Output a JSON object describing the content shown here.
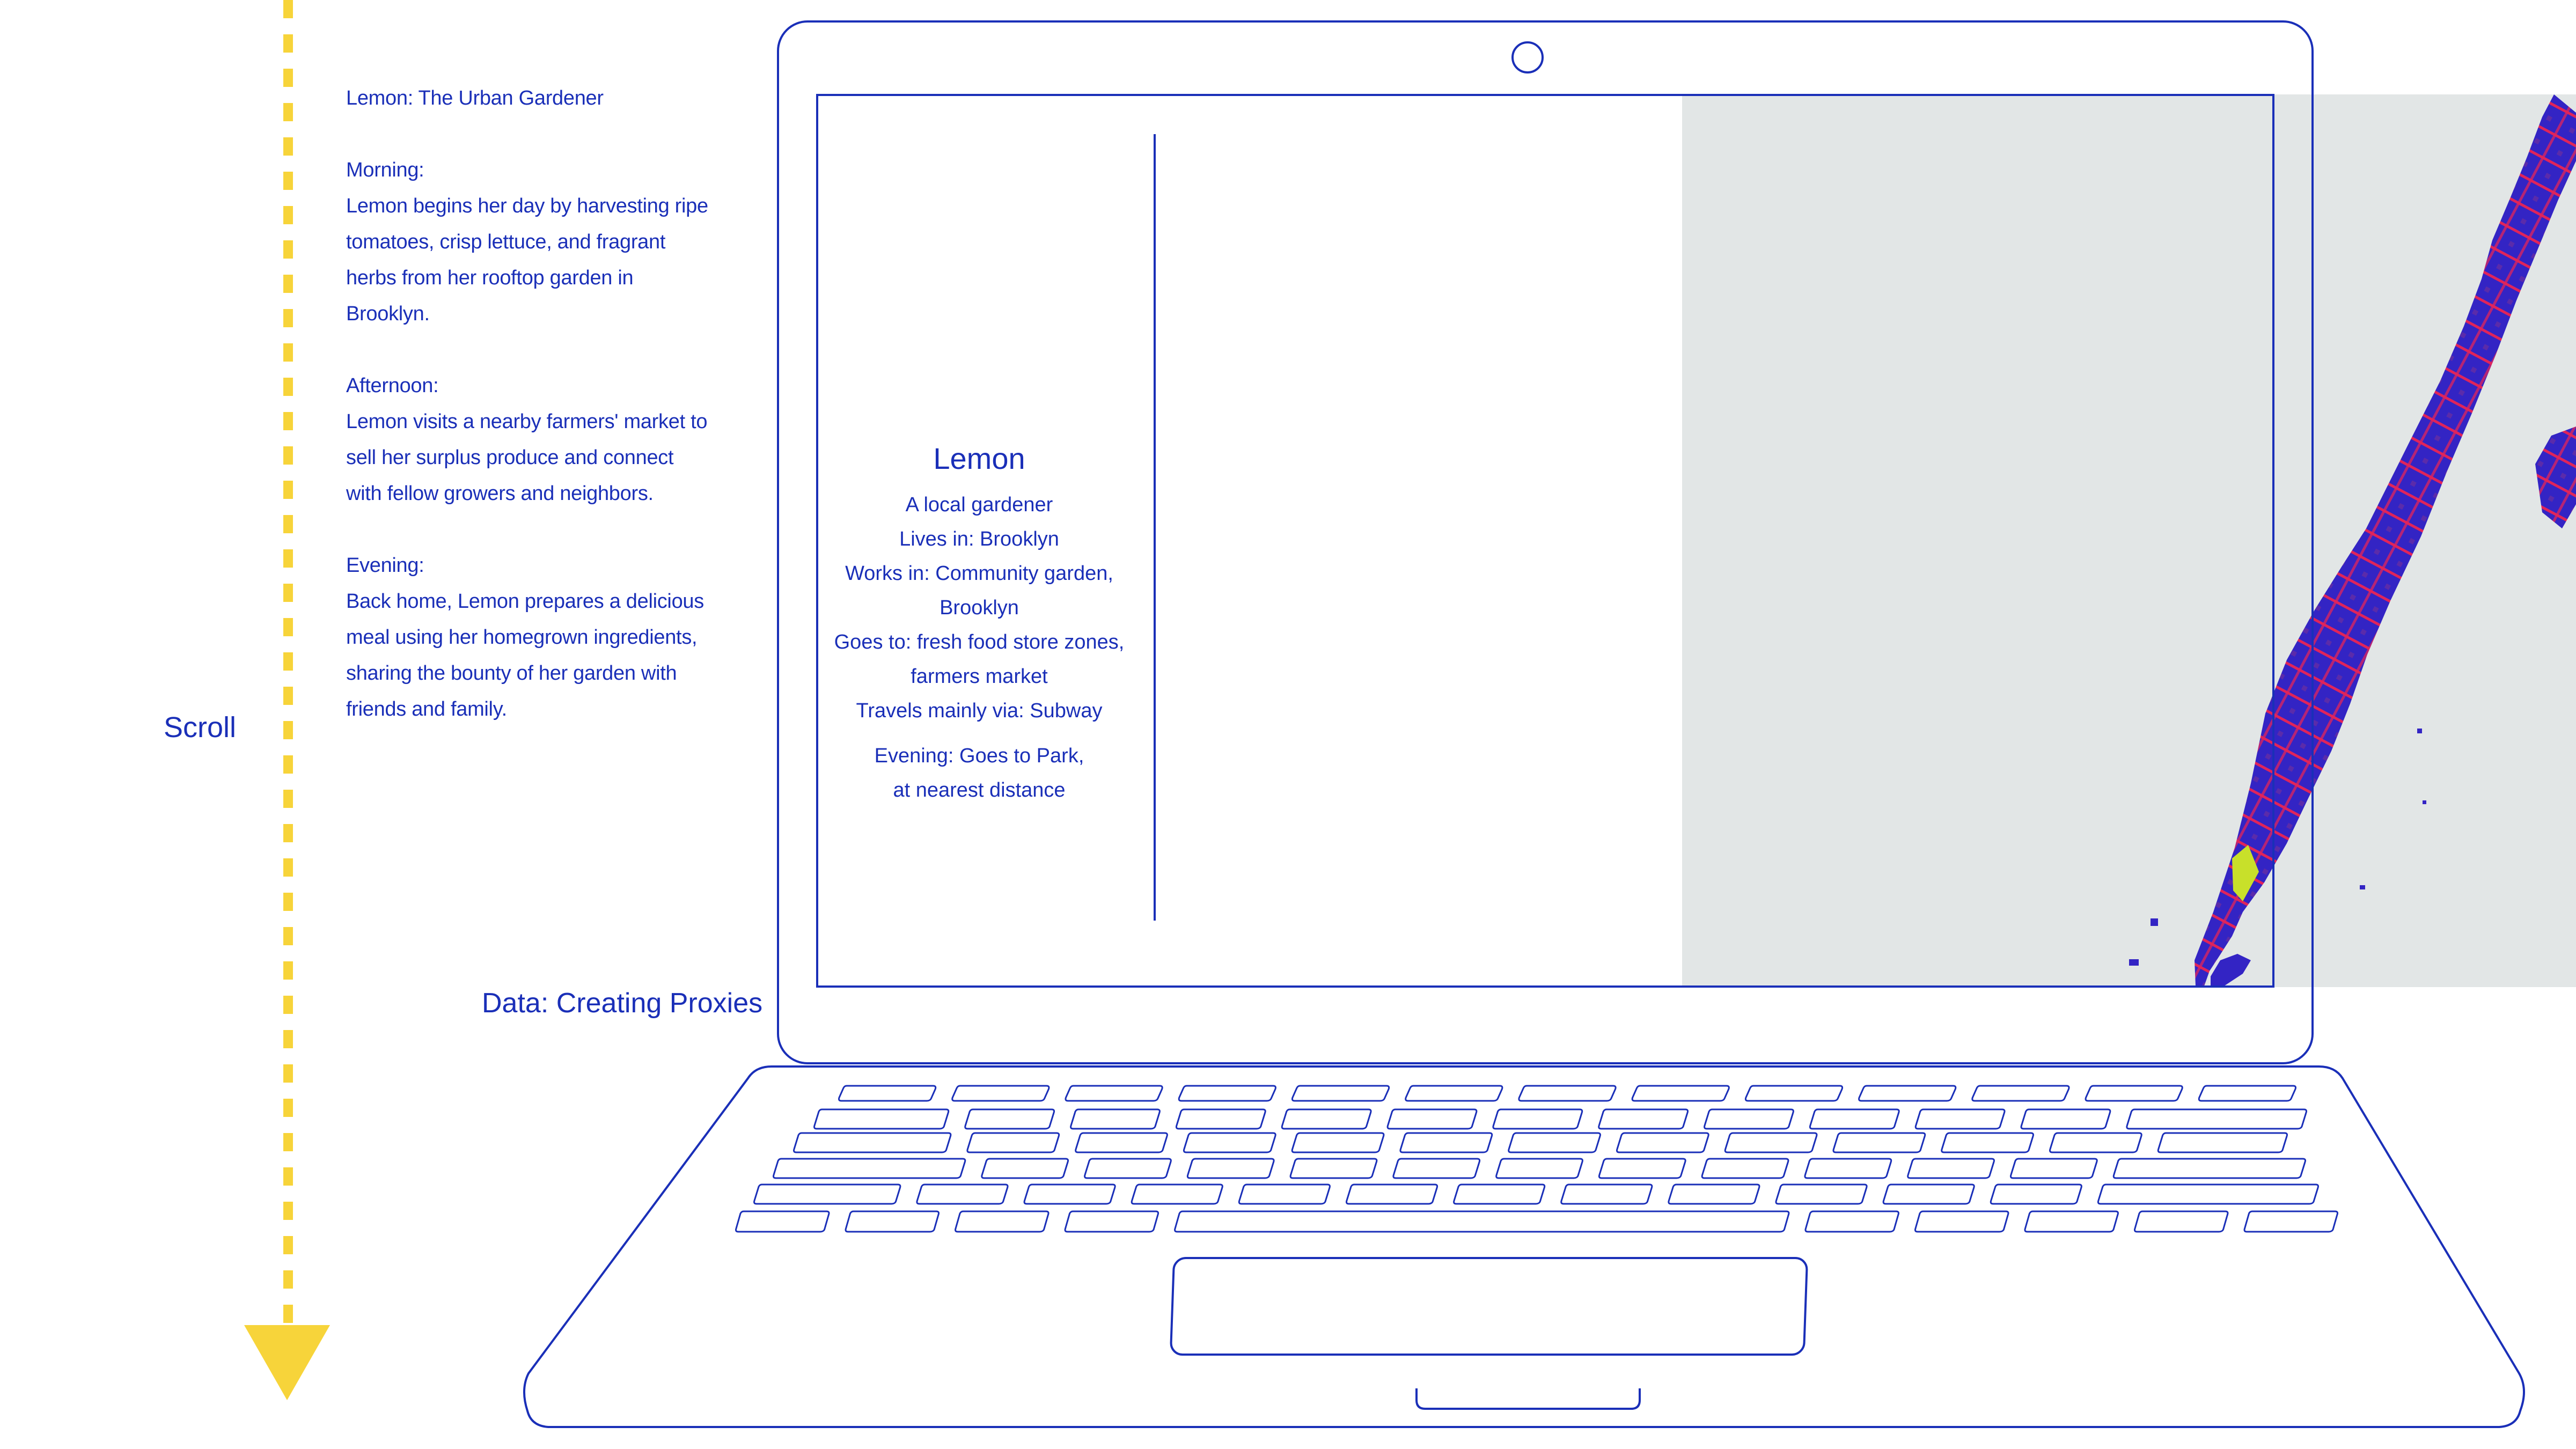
{
  "scroll": {
    "label": "Scroll"
  },
  "narrative": {
    "title": "Lemon: The Urban Gardener",
    "morning_heading": "Morning:",
    "morning_text_lines": [
      "Lemon begins her day by harvesting ripe",
      "tomatoes, crisp lettuce, and fragrant",
      "herbs from her rooftop garden in",
      "Brooklyn."
    ],
    "afternoon_heading": "Afternoon:",
    "afternoon_text_lines": [
      "Lemon visits a nearby farmers' market to",
      "sell her surplus produce and connect",
      "with fellow growers and neighbors."
    ],
    "evening_heading": "Evening:",
    "evening_text_lines": [
      "Back home, Lemon prepares a delicious",
      "meal using her homegrown ingredients,",
      "sharing the bounty of her garden with",
      "friends and family."
    ]
  },
  "data_label": "Data: Creating Proxies",
  "profile": {
    "name": "Lemon",
    "description": "A local gardener",
    "lives_in": "Lives in: Brooklyn",
    "works_in_lines": [
      "Works in: Community garden,",
      "Brooklyn"
    ],
    "goes_to_lines": [
      "Goes to: fresh food store zones,",
      "farmers market"
    ],
    "travels": "Travels mainly via: Subway",
    "evening_lines": [
      "Evening: Goes to Park,",
      "at nearest distance"
    ]
  },
  "colors": {
    "ink": "#1a2fb8",
    "arrow": "#f7d43a",
    "panel": "#e2e6e6",
    "map_base": "#3324c4",
    "map_streets": "#e0245a",
    "map_park": "#c8e02a"
  }
}
